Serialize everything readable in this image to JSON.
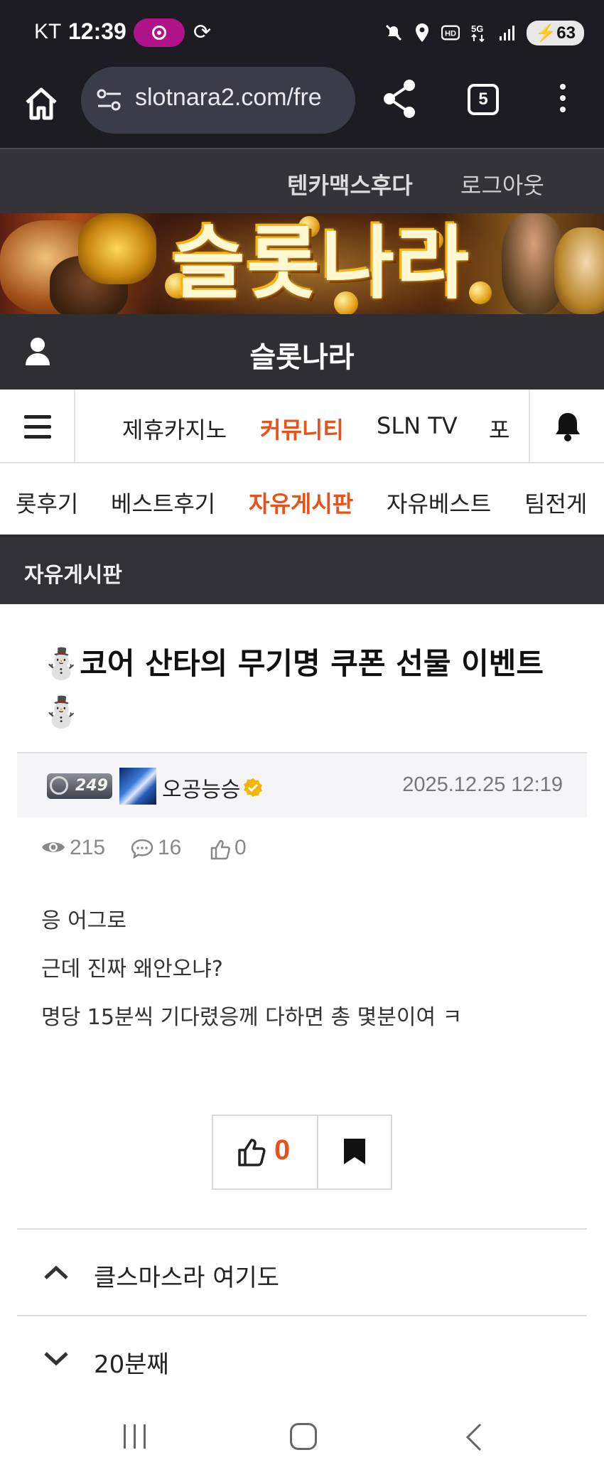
{
  "status_bar": {
    "carrier": "KT",
    "time": "12:39",
    "battery": "63"
  },
  "browser": {
    "url": "slotnara2.com/fre",
    "tab_count": "5"
  },
  "site_bar": {
    "username": "텐카맥스후다",
    "logout_label": "로그아웃"
  },
  "banner": {
    "title": "슬롯나라"
  },
  "site_title": "슬롯나라",
  "main_nav": {
    "items": [
      {
        "label": "제휴카지노",
        "active": false
      },
      {
        "label": "커뮤니티",
        "active": true
      },
      {
        "label": "SLN TV",
        "active": false
      },
      {
        "label": "포",
        "active": false
      }
    ]
  },
  "sub_nav": {
    "items": [
      {
        "label": "롯후기",
        "active": false
      },
      {
        "label": "베스트후기",
        "active": false
      },
      {
        "label": "자유게시판",
        "active": true
      },
      {
        "label": "자유베스트",
        "active": false
      },
      {
        "label": "팀전게",
        "active": false
      }
    ]
  },
  "board_title": "자유게시판",
  "post": {
    "title_line1": "⛄코어 산타의 무기명 쿠폰 선물 이벤트",
    "title_line2": "⛄",
    "level": "249",
    "author": "오공능승",
    "date": "2025.12.25 12:19",
    "views": "215",
    "comments": "16",
    "likes": "0",
    "body": [
      "응 어그로",
      "근데 진짜 왜안오냐?",
      "명당 15분씩 기다렸응께 다하면 총 몇분이여 ㅋ"
    ],
    "vote_count": "0"
  },
  "post_nav": {
    "prev_title": "클스마스라 여기도",
    "next_title": "20분째"
  },
  "icons": {
    "home": "home-icon",
    "share": "share-icon",
    "menu": "hamburger-icon",
    "bell": "bell-icon",
    "user": "person-icon",
    "eye": "eye-icon",
    "comment": "comment-icon",
    "thumb": "thumbs-up-icon",
    "bookmark": "bookmark-icon"
  },
  "colors": {
    "accent": "#e8521a",
    "dark_bar": "#2f2f33",
    "browser_bg": "#1c1c22"
  }
}
